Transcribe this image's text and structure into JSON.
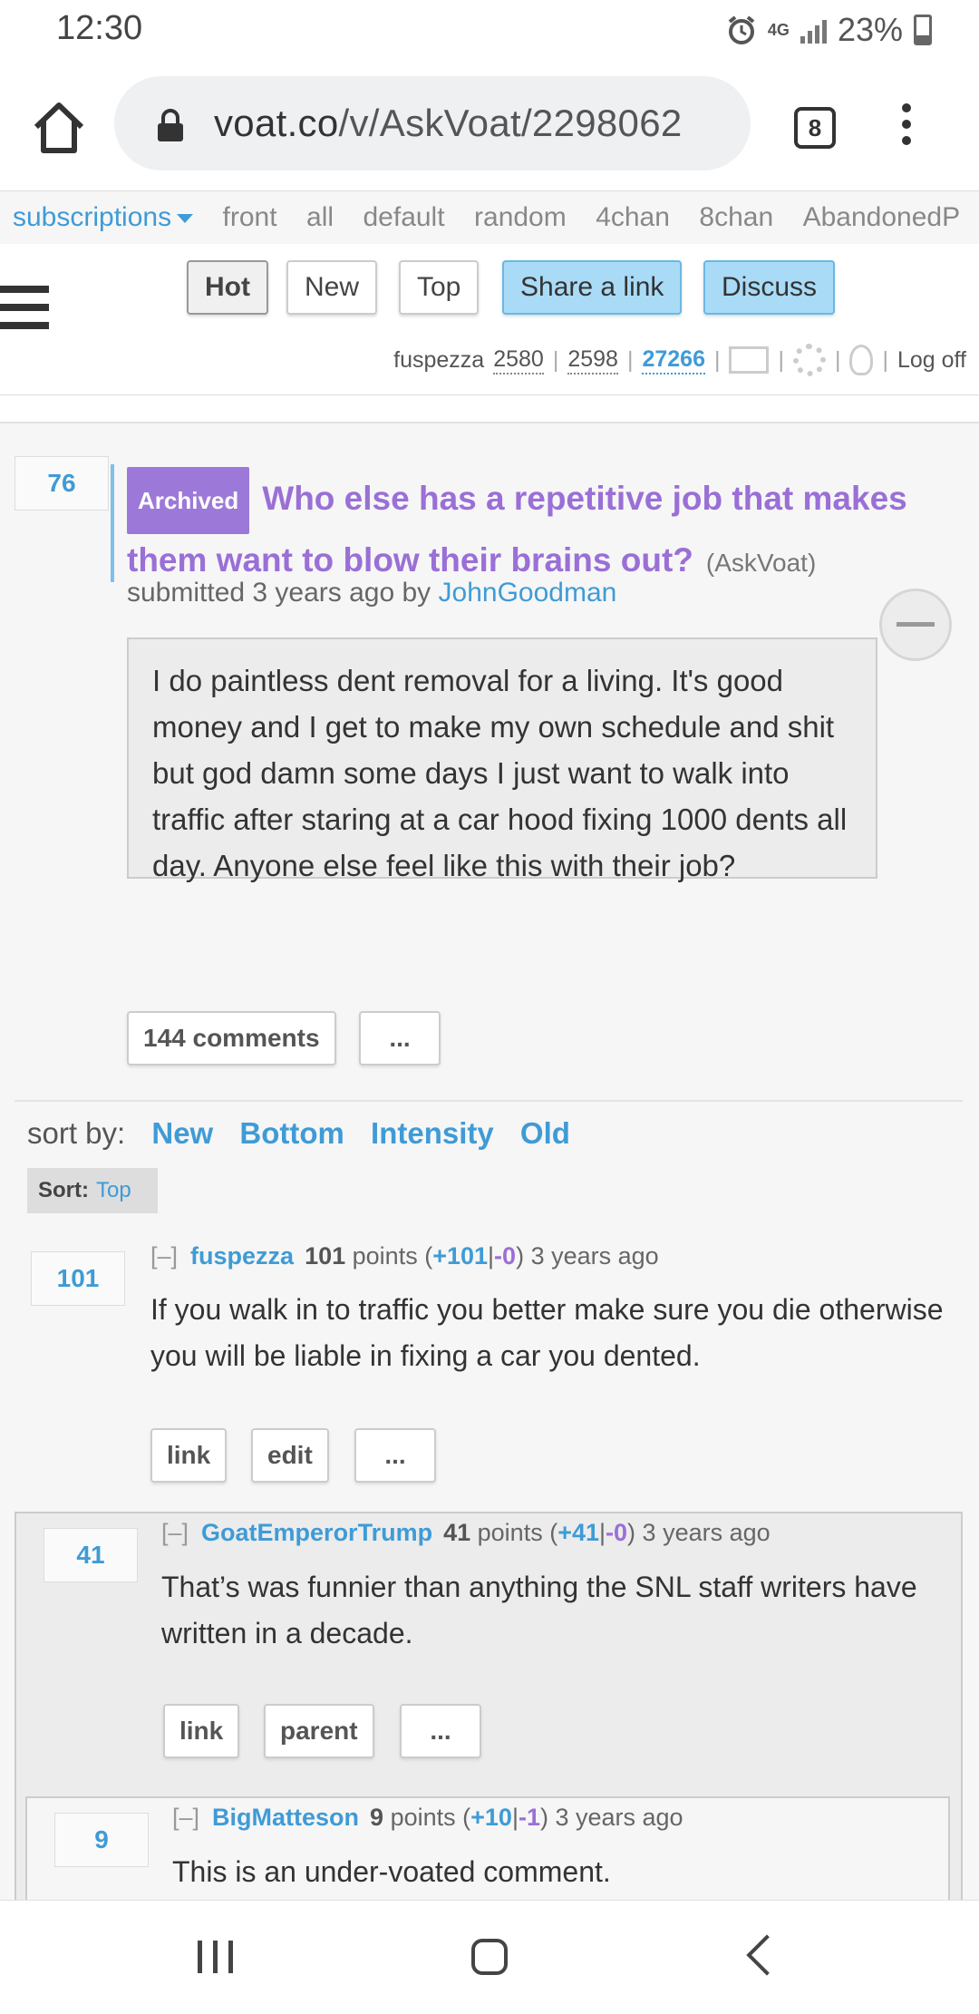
{
  "status_bar": {
    "time": "12:30",
    "network": "4G",
    "battery": "23%"
  },
  "browser": {
    "url_host": "voat.co",
    "url_path": "/v/AskVoat/2298062",
    "tab_count": "8"
  },
  "nav": {
    "subscriptions": "subscriptions",
    "links": [
      "front",
      "all",
      "default",
      "random",
      "4chan",
      "8chan",
      "AbandonedP"
    ]
  },
  "sort_tabs": {
    "hot": "Hot",
    "new": "New",
    "top": "Top",
    "share": "Share a link",
    "discuss": "Discuss"
  },
  "user": {
    "name": "fuspezza",
    "ccp": "2580",
    "scp": "2598",
    "total": "27266",
    "logoff": "Log off"
  },
  "post": {
    "score": "76",
    "archived": "Archived",
    "title": "Who else has a repetitive job that makes them want to blow their brains out?",
    "subverse": "(AskVoat)",
    "submitted_prefix": "submitted 3 years ago by",
    "author": "JohnGoodman",
    "body": "I do paintless dent removal for a living. It's good money and I get to make my own schedule and shit but god damn some days I just want to walk into traffic after staring at a car hood fixing 1000 dents all day. Anyone else feel like this with their job?",
    "comments_button": "144 comments",
    "more_button": "..."
  },
  "sort": {
    "label": "sort by:",
    "options": [
      "New",
      "Bottom",
      "Intensity",
      "Old"
    ],
    "current_label": "Sort:",
    "current_value": "Top"
  },
  "comments": [
    {
      "score": "101",
      "collapse": "[–]",
      "author": "fuspezza",
      "points": "101",
      "points_word": "points",
      "up": "+101",
      "down": "-0",
      "age": "3 years ago",
      "body": "If you walk in to traffic you better make sure you die otherwise you will be liable in fixing a car you dented.",
      "actions": [
        "link",
        "edit",
        "..."
      ]
    },
    {
      "score": "41",
      "collapse": "[–]",
      "author": "GoatEmperorTrump",
      "points": "41",
      "points_word": "points",
      "up": "+41",
      "down": "-0",
      "age": "3 years ago",
      "body": "That’s was funnier than anything the SNL staff writers have written in a decade.",
      "actions": [
        "link",
        "parent",
        "..."
      ]
    },
    {
      "score": "9",
      "collapse": "[–]",
      "author": "BigMatteson",
      "points": "9",
      "points_word": "points",
      "up": "+10",
      "down": "-1",
      "age": "3 years ago",
      "body": "This is an under-voated comment."
    }
  ]
}
